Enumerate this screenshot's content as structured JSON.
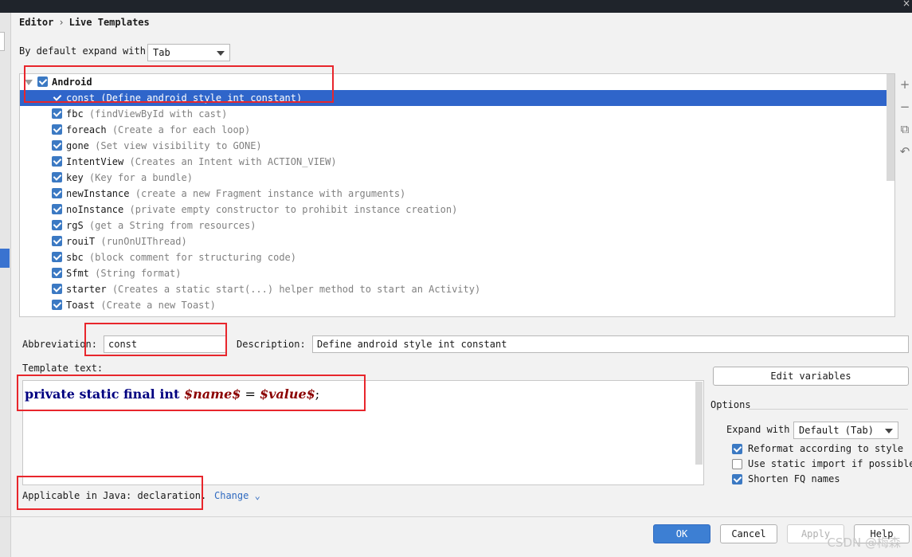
{
  "breadcrumb": {
    "part1": "Editor",
    "separator": "›",
    "part2": "Live Templates"
  },
  "expand": {
    "label": "By default expand with",
    "value": "Tab"
  },
  "group": {
    "name": "Android",
    "checked": true
  },
  "templates": [
    {
      "name": "const",
      "desc": "(Define android style int constant)",
      "selected": true
    },
    {
      "name": "fbc",
      "desc": "(findViewById with cast)"
    },
    {
      "name": "foreach",
      "desc": "(Create a for each loop)"
    },
    {
      "name": "gone",
      "desc": "(Set view visibility to GONE)"
    },
    {
      "name": "IntentView",
      "desc": "(Creates an Intent with ACTION_VIEW)"
    },
    {
      "name": "key",
      "desc": "(Key for a bundle)"
    },
    {
      "name": "newInstance",
      "desc": "(create a new Fragment instance with arguments)"
    },
    {
      "name": "noInstance",
      "desc": "(private empty constructor to prohibit instance creation)"
    },
    {
      "name": "rgS",
      "desc": "(get a String from resources)"
    },
    {
      "name": "rouiT",
      "desc": "(runOnUIThread)"
    },
    {
      "name": "sbc",
      "desc": "(block comment for structuring code)"
    },
    {
      "name": "Sfmt",
      "desc": "(String format)"
    },
    {
      "name": "starter",
      "desc": "(Creates a static start(...) helper method to start an Activity)"
    },
    {
      "name": "Toast",
      "desc": "(Create a new Toast)"
    }
  ],
  "sidetools": {
    "add": "+",
    "remove": "−",
    "copy": "⧉",
    "restore": "↶"
  },
  "abbreviation": {
    "label": "Abbreviation:",
    "value": "const"
  },
  "description": {
    "label": "Description:",
    "value": "Define android style int constant"
  },
  "template_text": {
    "label": "Template text:",
    "kw": "private static final int",
    "var1": "$name$",
    "eq": " = ",
    "var2": "$value$",
    "end": ";"
  },
  "edit_variables": "Edit variables",
  "options": {
    "title": "Options",
    "expand_label": "Expand with",
    "expand_value": "Default (Tab)",
    "reformat": "Reformat according to style",
    "static_import": "Use static import if possible",
    "shorten": "Shorten FQ names"
  },
  "applicable": {
    "text": "Applicable in Java: declaration.",
    "change": "Change"
  },
  "buttons": {
    "ok": "OK",
    "cancel": "Cancel",
    "apply": "Apply",
    "help": "Help"
  },
  "watermark": "CSDN @梅森",
  "colors": {
    "selection": "#2f65ca",
    "accent": "#3d7fd3",
    "highlight_box": "#e8262c"
  }
}
